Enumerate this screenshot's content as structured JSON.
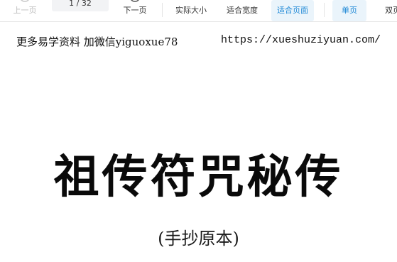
{
  "toolbar": {
    "prev_page": "上一页",
    "page_current": "1",
    "page_total": "/ 32",
    "next_page": "下一页",
    "actual_size": "实际大小",
    "fit_width": "适合宽度",
    "fit_page": "适合页面",
    "single_page": "单页",
    "double_page": "双页",
    "accent_color": "#1e88d6"
  },
  "document": {
    "header_left": "更多易学资料 加微信yiguoxue78",
    "header_url": "https://xueshuziyuan.com/",
    "title": "祖传符咒秘传",
    "subtitle": "(手抄原本)"
  }
}
